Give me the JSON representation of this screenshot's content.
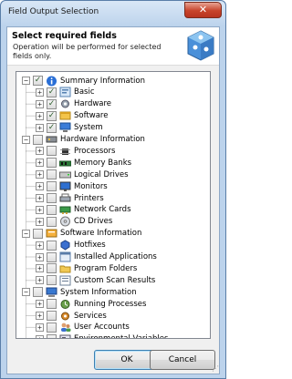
{
  "window": {
    "title": "Field Output Selection",
    "close_label": "✕"
  },
  "header": {
    "title": "Select required fields",
    "subtitle": "Operation will be performed for selected fields only."
  },
  "tree": [
    {
      "label": "Summary Information",
      "level": 0,
      "checked": true,
      "icon": "info-icon"
    },
    {
      "label": "Basic",
      "level": 1,
      "checked": true,
      "icon": "basic-icon"
    },
    {
      "label": "Hardware",
      "level": 1,
      "checked": true,
      "icon": "hardware-icon"
    },
    {
      "label": "Software",
      "level": 1,
      "checked": true,
      "icon": "software-icon"
    },
    {
      "label": "System",
      "level": 1,
      "checked": true,
      "icon": "system-icon"
    },
    {
      "label": "Hardware Information",
      "level": 0,
      "checked": false,
      "icon": "hardware-info-icon"
    },
    {
      "label": "Processors",
      "level": 1,
      "checked": false,
      "icon": "processor-icon"
    },
    {
      "label": "Memory Banks",
      "level": 1,
      "checked": false,
      "icon": "memory-icon"
    },
    {
      "label": "Logical Drives",
      "level": 1,
      "checked": false,
      "icon": "drive-icon"
    },
    {
      "label": "Monitors",
      "level": 1,
      "checked": false,
      "icon": "monitor-icon"
    },
    {
      "label": "Printers",
      "level": 1,
      "checked": false,
      "icon": "printer-icon"
    },
    {
      "label": "Network Cards",
      "level": 1,
      "checked": false,
      "icon": "network-card-icon"
    },
    {
      "label": "CD Drives",
      "level": 1,
      "checked": false,
      "icon": "cd-icon"
    },
    {
      "label": "Software Information",
      "level": 0,
      "checked": false,
      "icon": "software-info-icon"
    },
    {
      "label": "Hotfixes",
      "level": 1,
      "checked": false,
      "icon": "hotfix-icon"
    },
    {
      "label": "Installed Applications",
      "level": 1,
      "checked": false,
      "icon": "applications-icon"
    },
    {
      "label": "Program Folders",
      "level": 1,
      "checked": false,
      "icon": "folder-icon"
    },
    {
      "label": "Custom Scan Results",
      "level": 1,
      "checked": false,
      "icon": "scan-results-icon"
    },
    {
      "label": "System Information",
      "level": 0,
      "checked": false,
      "icon": "system-info-icon"
    },
    {
      "label": "Running Processes",
      "level": 1,
      "checked": false,
      "icon": "process-icon"
    },
    {
      "label": "Services",
      "level": 1,
      "checked": false,
      "icon": "services-icon"
    },
    {
      "label": "User Accounts",
      "level": 1,
      "checked": false,
      "icon": "users-icon"
    },
    {
      "label": "Environmental Variables",
      "level": 1,
      "checked": false,
      "icon": "env-vars-icon"
    }
  ],
  "buttons": {
    "ok": "OK",
    "cancel": "Cancel"
  },
  "colors": {
    "title_bar": "#bcd3ec",
    "close_button": "#c7432a",
    "check": "#2c5d2c"
  }
}
